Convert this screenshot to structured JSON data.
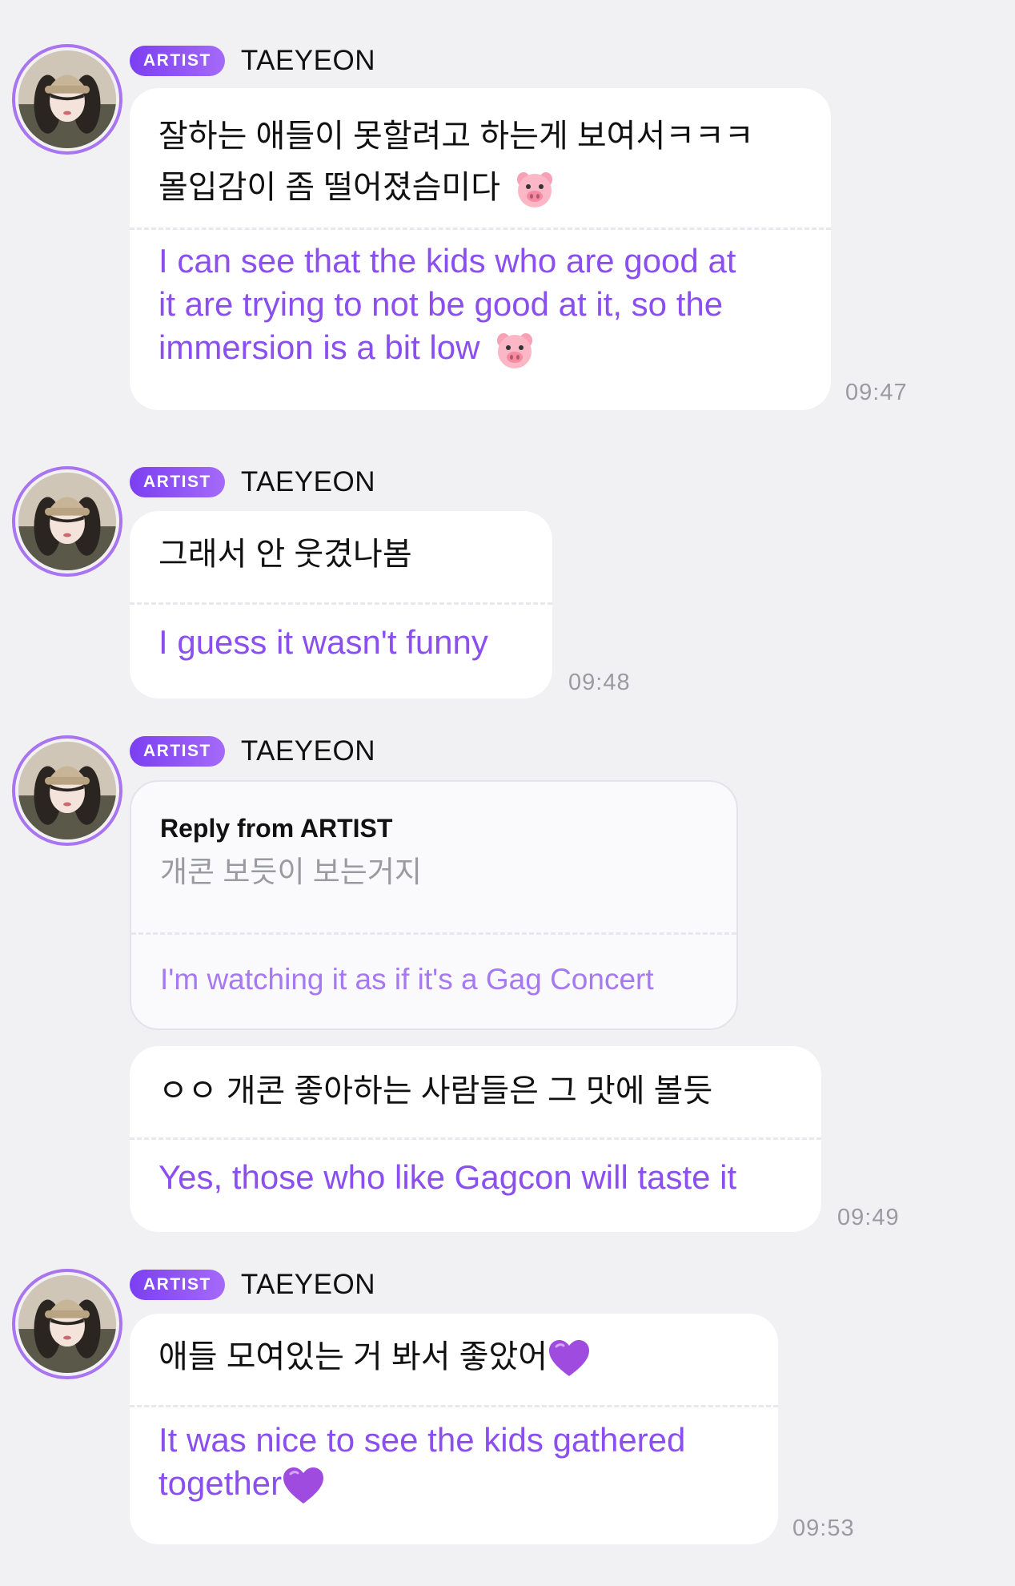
{
  "messages": [
    {
      "badge": "ARTIST",
      "sender": "TAEYEON",
      "ko_lines": [
        "잘하는 애들이 못할려고 하는게 보여서ㅋㅋㅋ",
        "몰입감이 좀 떨어졌슴미다"
      ],
      "en_lines": [
        "I can see that the kids who are good at",
        "it are trying to not be good at it, so the",
        "immersion is a bit low"
      ],
      "emoji": "pig-face-icon",
      "time": "09:47"
    },
    {
      "badge": "ARTIST",
      "sender": "TAEYEON",
      "ko_lines": [
        "그래서 안 웃겼나봄"
      ],
      "en_lines": [
        "I guess it wasn't funny"
      ],
      "time": "09:48"
    },
    {
      "badge": "ARTIST",
      "sender": "TAEYEON",
      "reply": {
        "title": "Reply from ARTIST",
        "ko": "개콘 보듯이 보는거지",
        "en": "I'm watching it as if it's a Gag Concert"
      },
      "ko_lines": [
        "ㅇㅇ 개콘 좋아하는 사람들은 그 맛에 볼듯"
      ],
      "en_lines": [
        "Yes, those who like Gagcon will taste it"
      ],
      "time": "09:49"
    },
    {
      "badge": "ARTIST",
      "sender": "TAEYEON",
      "ko_lines": [
        "애들 모여있는 거 봐서 좋았어"
      ],
      "en_lines": [
        "It was nice to see the kids gathered",
        "together"
      ],
      "emoji": "purple-heart-icon",
      "time": "09:53"
    }
  ],
  "colors": {
    "accent": "#8b4ff0",
    "badge_start": "#7b3ff2",
    "badge_end": "#a56af8",
    "background": "#f1f1f4",
    "timestamp": "#9a9aa1"
  }
}
